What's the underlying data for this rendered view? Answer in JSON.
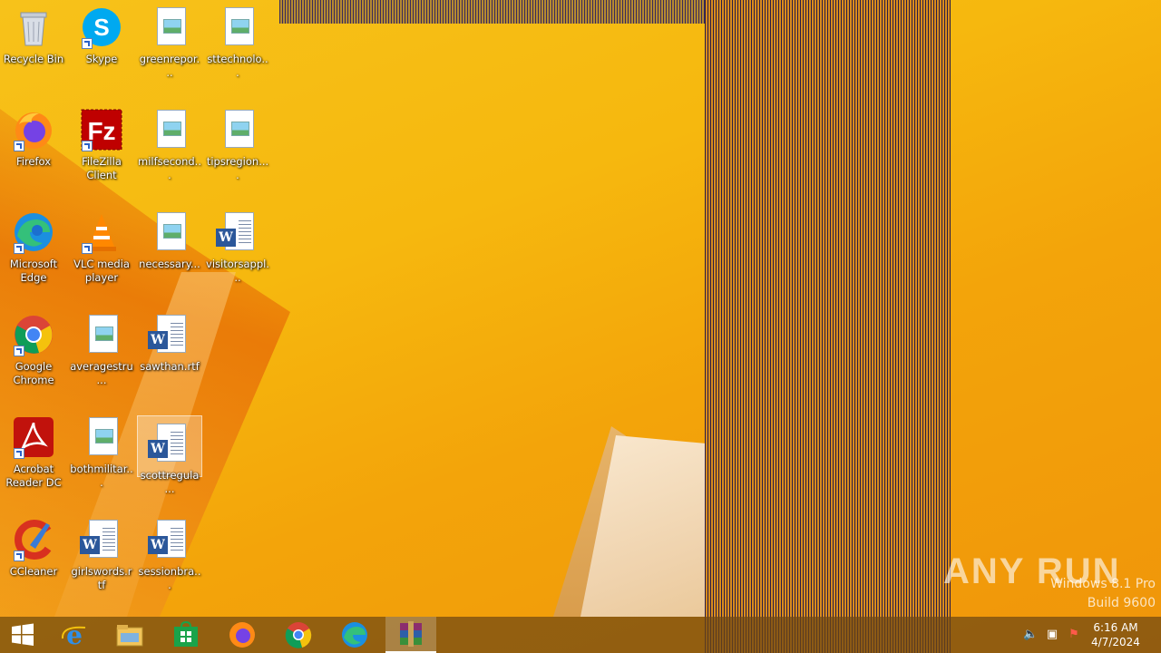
{
  "desktop": {
    "icons": [
      {
        "label": "Recycle Bin"
      },
      {
        "label": "Skype"
      },
      {
        "label": "greenrepor..."
      },
      {
        "label": "sttechnolo..."
      },
      {
        "label": "Firefox"
      },
      {
        "label": "FileZilla Client"
      },
      {
        "label": "milfsecond..."
      },
      {
        "label": "tipsregion...."
      },
      {
        "label": "Microsoft Edge"
      },
      {
        "label": "VLC media player"
      },
      {
        "label": "necessary..."
      },
      {
        "label": "visitorsappl..."
      },
      {
        "label": "Google Chrome"
      },
      {
        "label": "averagestru..."
      },
      {
        "label": "sawthan.rtf"
      },
      {
        "label": "Acrobat Reader DC"
      },
      {
        "label": "bothmilitar..."
      },
      {
        "label": "scottregula..."
      },
      {
        "label": "CCleaner"
      },
      {
        "label": "girlswords.rtf"
      },
      {
        "label": "sessionbra..."
      }
    ]
  },
  "watermark": {
    "brand": "ANY RUN",
    "os": "Windows 8.1 Pro",
    "build": "Build 9600"
  },
  "taskbar": {
    "items": [
      "start-icon",
      "internet-explorer-icon",
      "file-explorer-icon",
      "store-icon",
      "firefox-icon",
      "chrome-icon",
      "edge-icon",
      "winrar-icon"
    ],
    "clock": {
      "time": "6:16 AM",
      "date": "4/7/2024"
    }
  }
}
